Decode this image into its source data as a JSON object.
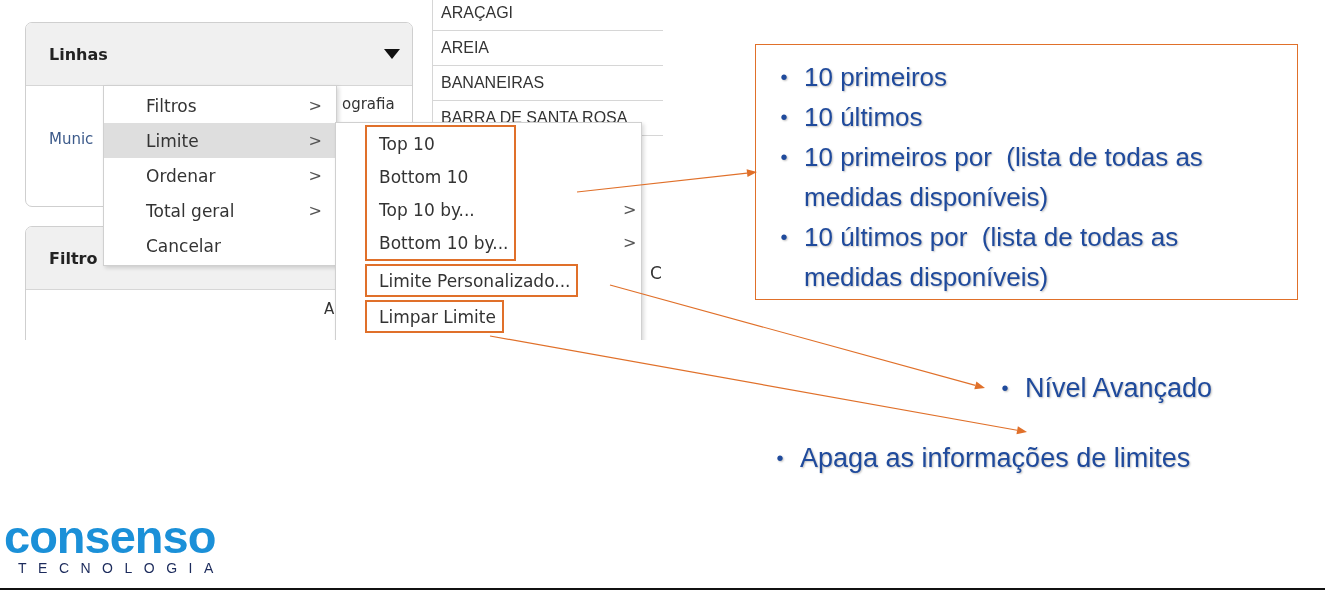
{
  "screenshot": {
    "rows_panel": {
      "title": "Linhas",
      "field": "Munic",
      "column_header": "ografia"
    },
    "filters_panel": {
      "title": "Filtro",
      "column_header": "A"
    },
    "list": {
      "rows": [
        "ARAÇAGI",
        "AREIA",
        "BANANEIRAS",
        "BARRA DE SANTA ROSA"
      ],
      "cell": "C"
    },
    "menu": [
      {
        "label": "Filtros",
        "arrow": ">",
        "selected": false
      },
      {
        "label": "Limite",
        "arrow": ">",
        "selected": true
      },
      {
        "label": "Ordenar",
        "arrow": ">",
        "selected": false
      },
      {
        "label": "Total geral",
        "arrow": ">",
        "selected": false
      },
      {
        "label": "Cancelar",
        "selected": false
      }
    ],
    "submenu_groups": [
      {
        "items": [
          {
            "label": "Top 10"
          },
          {
            "label": "Bottom 10"
          },
          {
            "label": "Top 10 by...",
            "arrow": ">"
          },
          {
            "label": "Bottom 10 by...",
            "arrow": ">"
          }
        ]
      },
      {
        "items": [
          {
            "label": "Limite Personalizado..."
          }
        ]
      },
      {
        "items": [
          {
            "label": "Limpar Limite"
          }
        ]
      }
    ]
  },
  "notes": [
    {
      "kind": "box",
      "bullets": [
        {
          "marker": "•",
          "text": "10 primeiros"
        },
        {
          "marker": "•",
          "text": "10 últimos"
        },
        {
          "marker": "•",
          "text": "10 primeiros por  (lista de todas as medidas disponíveis)"
        },
        {
          "marker": "•",
          "text": "10 últimos por  (lista de todas as medidas disponíveis)"
        }
      ]
    },
    {
      "kind": "line",
      "marker": "•",
      "text": "Nível Avançado"
    },
    {
      "kind": "line",
      "marker": "•",
      "text": "Apaga as informações de limites"
    }
  ],
  "logo": {
    "name": "consenso",
    "tagline": "TECNOLOGIA"
  }
}
